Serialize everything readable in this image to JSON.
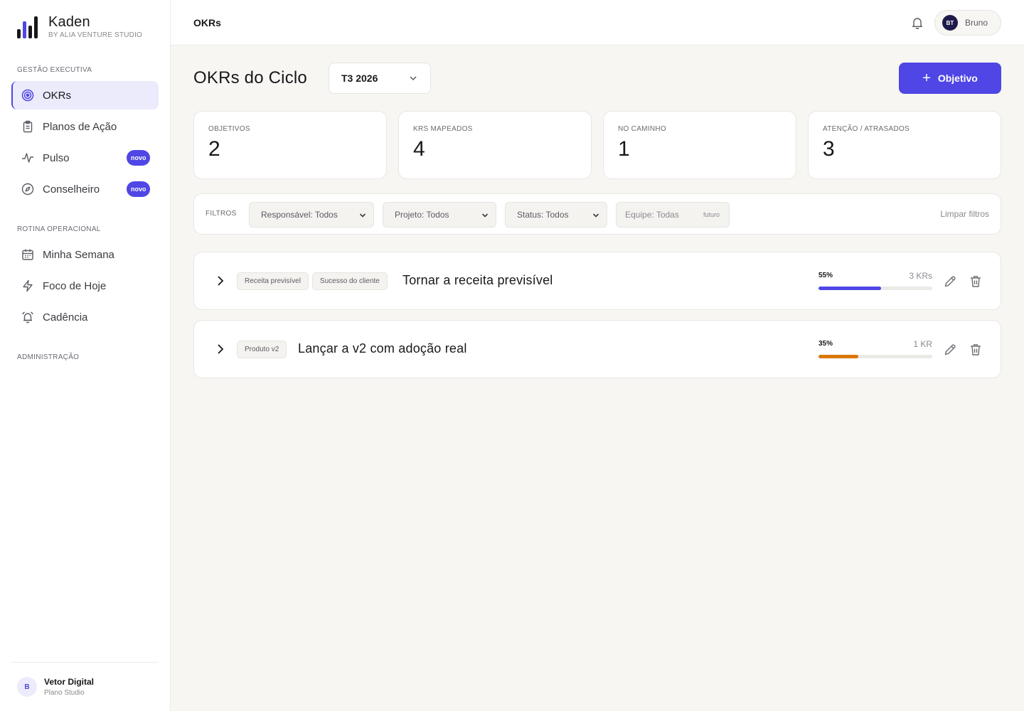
{
  "brand": {
    "name": "Kaden",
    "subtitle": "BY ALIA VENTURE STUDIO"
  },
  "sidebar": {
    "sections": [
      {
        "label": "GESTÃO EXECUTIVA"
      },
      {
        "label": "ROTINA OPERACIONAL"
      },
      {
        "label": "ADMINISTRAÇÃO"
      }
    ],
    "items": [
      {
        "label": "OKRs",
        "icon": "target-icon"
      },
      {
        "label": "Planos de Ação",
        "icon": "clipboard-icon"
      },
      {
        "label": "Pulso",
        "icon": "pulse-icon",
        "badge": "novo"
      },
      {
        "label": "Conselheiro",
        "icon": "compass-icon",
        "badge": "novo"
      },
      {
        "label": "Minha Semana",
        "icon": "calendar-icon"
      },
      {
        "label": "Foco de Hoje",
        "icon": "lightning-icon"
      },
      {
        "label": "Cadência",
        "icon": "alarm-icon"
      }
    ],
    "user": {
      "initial": "B",
      "name": "Vetor Digital",
      "org": "Plano Studio"
    }
  },
  "topbar": {
    "title": "OKRs",
    "profile": {
      "initials": "BT",
      "name": "Bruno"
    }
  },
  "main": {
    "title": "OKRs do Ciclo",
    "cycle": "T3 2026",
    "add_button": "Objetivo",
    "stats": [
      {
        "label": "OBJETIVOS",
        "value": "2"
      },
      {
        "label": "KRS MAPEADOS",
        "value": "4"
      },
      {
        "label": "NO CAMINHO",
        "value": "1"
      },
      {
        "label": "ATENÇÃO / ATRASADOS",
        "value": "3"
      }
    ],
    "filters": {
      "label": "FILTROS",
      "responsavel": "Responsável: Todos",
      "projeto": "Projeto: Todos",
      "status": "Status: Todos",
      "equipe": "Equipe: Todas",
      "equipe_tag": "futuro",
      "clear": "Limpar filtros"
    },
    "objectives": [
      {
        "tags": [
          "Receita previsível",
          "Sucesso do cliente"
        ],
        "title": "Tornar a receita previsível",
        "progress": 55,
        "progress_label": "55%",
        "krs": "3 KRs",
        "color": "#4f46e5"
      },
      {
        "tags": [
          "Produto v2"
        ],
        "title": "Lançar a v2 com adoção real",
        "progress": 35,
        "progress_label": "35%",
        "krs": "1 KR",
        "color": "#d97706"
      }
    ]
  }
}
